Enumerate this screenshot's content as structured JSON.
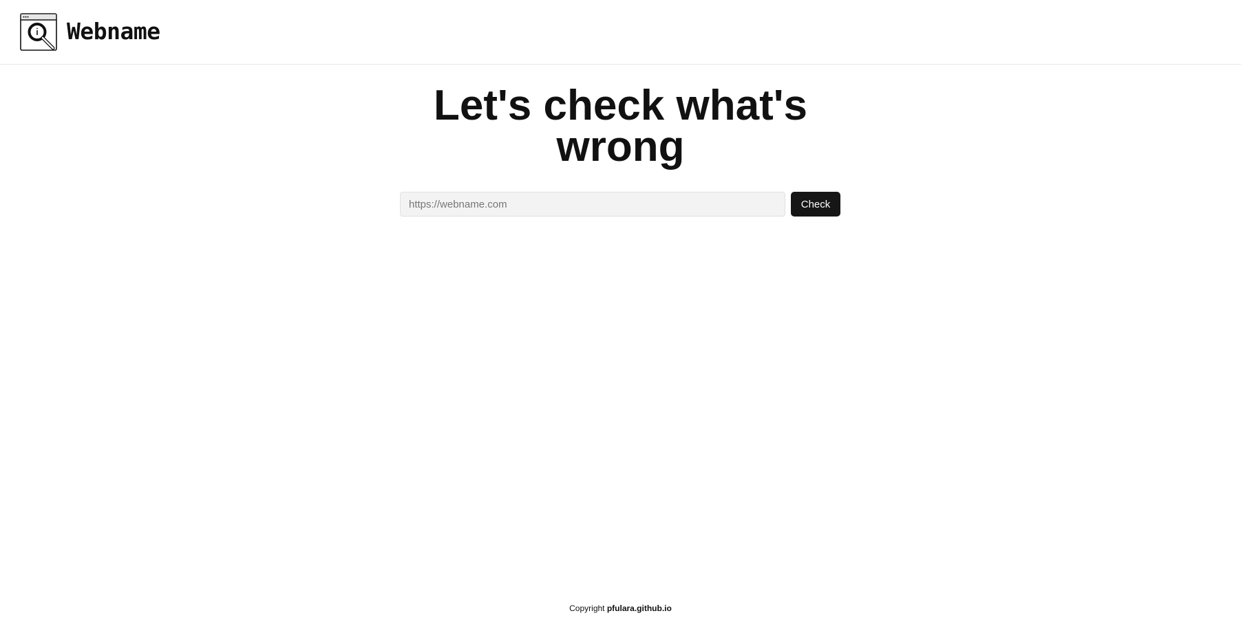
{
  "header": {
    "logo_icon": "magnifier-browser-icon",
    "brand_name": "Webname"
  },
  "main": {
    "headline_line1": "Let's check what's",
    "headline_line2": "wrong",
    "url_input": {
      "value": "",
      "placeholder": "https://webname.com"
    },
    "check_button_label": "Check"
  },
  "footer": {
    "copyright_prefix": "Copyright",
    "copyright_link": "pfulara.github.io"
  },
  "colors": {
    "text": "#111111",
    "button_bg": "#161616",
    "input_bg": "#f3f3f3",
    "divider": "#e8e8e8"
  }
}
